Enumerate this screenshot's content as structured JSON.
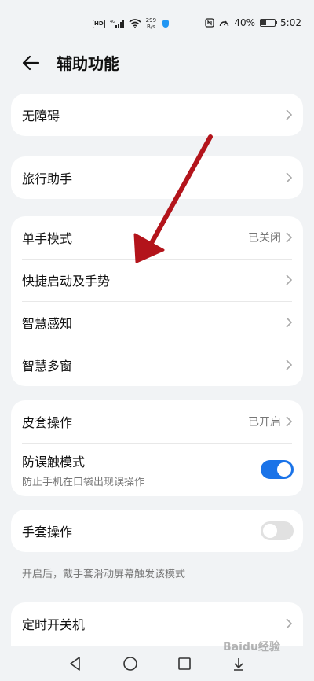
{
  "status_bar": {
    "hd": "HD",
    "net_speed_value": "299",
    "net_speed_unit": "B/s",
    "battery_percent": "40%",
    "battery_level": 0.4,
    "time": "5:02"
  },
  "header": {
    "title": "辅助功能"
  },
  "cards": {
    "accessibility": {
      "label": "无障碍"
    },
    "travel": {
      "label": "旅行助手"
    },
    "group1": {
      "one_hand": {
        "label": "单手模式",
        "value": "已关闭"
      },
      "shortcuts": {
        "label": "快捷启动及手势"
      },
      "smart_sense": {
        "label": "智慧感知"
      },
      "multi_window": {
        "label": "智慧多窗"
      }
    },
    "group2": {
      "cover": {
        "label": "皮套操作",
        "value": "已开启"
      },
      "anti_mistouch": {
        "label": "防误触模式",
        "sub": "防止手机在口袋出现误操作",
        "enabled": true
      }
    },
    "glove": {
      "label": "手套操作",
      "enabled": false
    },
    "glove_hint": "开启后，戴手套滑动屏幕触发该模式",
    "scheduled_power": {
      "label": "定时开关机"
    }
  },
  "watermark": "Baidu经验",
  "colors": {
    "accent": "#1a73e8",
    "background": "#f1f3f5",
    "annotation_arrow": "#b3141b"
  }
}
